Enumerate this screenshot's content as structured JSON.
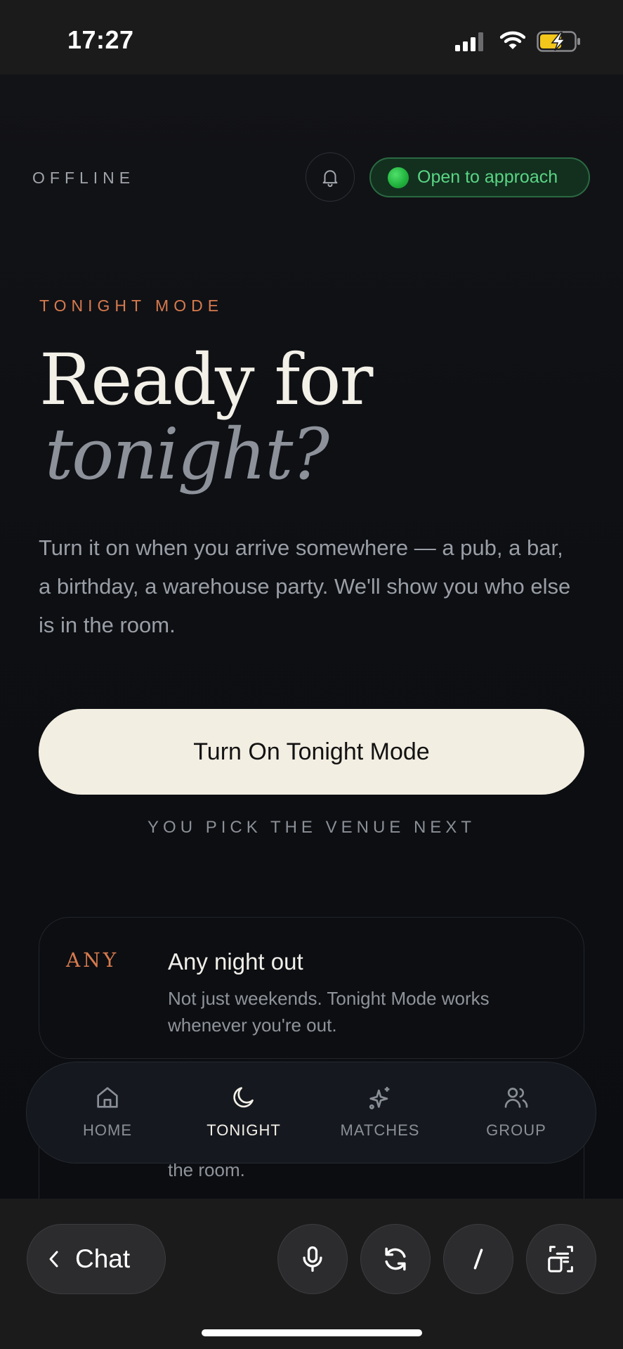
{
  "status_bar": {
    "time": "17:27"
  },
  "header": {
    "connection_status": "OFFLINE",
    "approach_badge": "Open to approach"
  },
  "hero": {
    "eyebrow": "TONIGHT MODE",
    "title_line1": "Ready for",
    "title_line2": "tonight?",
    "body": "Turn it on when you arrive somewhere — a pub, a bar, a birthday, a warehouse party. We'll show you who else is in the room."
  },
  "cta": {
    "label": "Turn On Tonight Mode",
    "subtext": "YOU PICK THE VENUE NEXT"
  },
  "cards": [
    {
      "tag": "ANY",
      "title": "Any night out",
      "description": "Not just weekends. Tonight Mode works whenever you're out."
    },
    {
      "description_visible_tail": "the room."
    }
  ],
  "tabbar": {
    "tabs": [
      {
        "label": "HOME",
        "icon": "home-icon",
        "active": false
      },
      {
        "label": "TONIGHT",
        "icon": "moon-icon",
        "active": true
      },
      {
        "label": "MATCHES",
        "icon": "sparkles-icon",
        "active": false
      },
      {
        "label": "GROUP",
        "icon": "users-icon",
        "active": false
      }
    ]
  },
  "toolbar": {
    "back_label": "Chat",
    "buttons": [
      "microphone-icon",
      "refresh-icon",
      "slash-icon",
      "screen-capture-icon"
    ]
  },
  "colors": {
    "accent_orange": "#d77a4e",
    "online_green": "#5ad584",
    "cta_background": "#f3eee2",
    "background": "#0b0d11"
  }
}
